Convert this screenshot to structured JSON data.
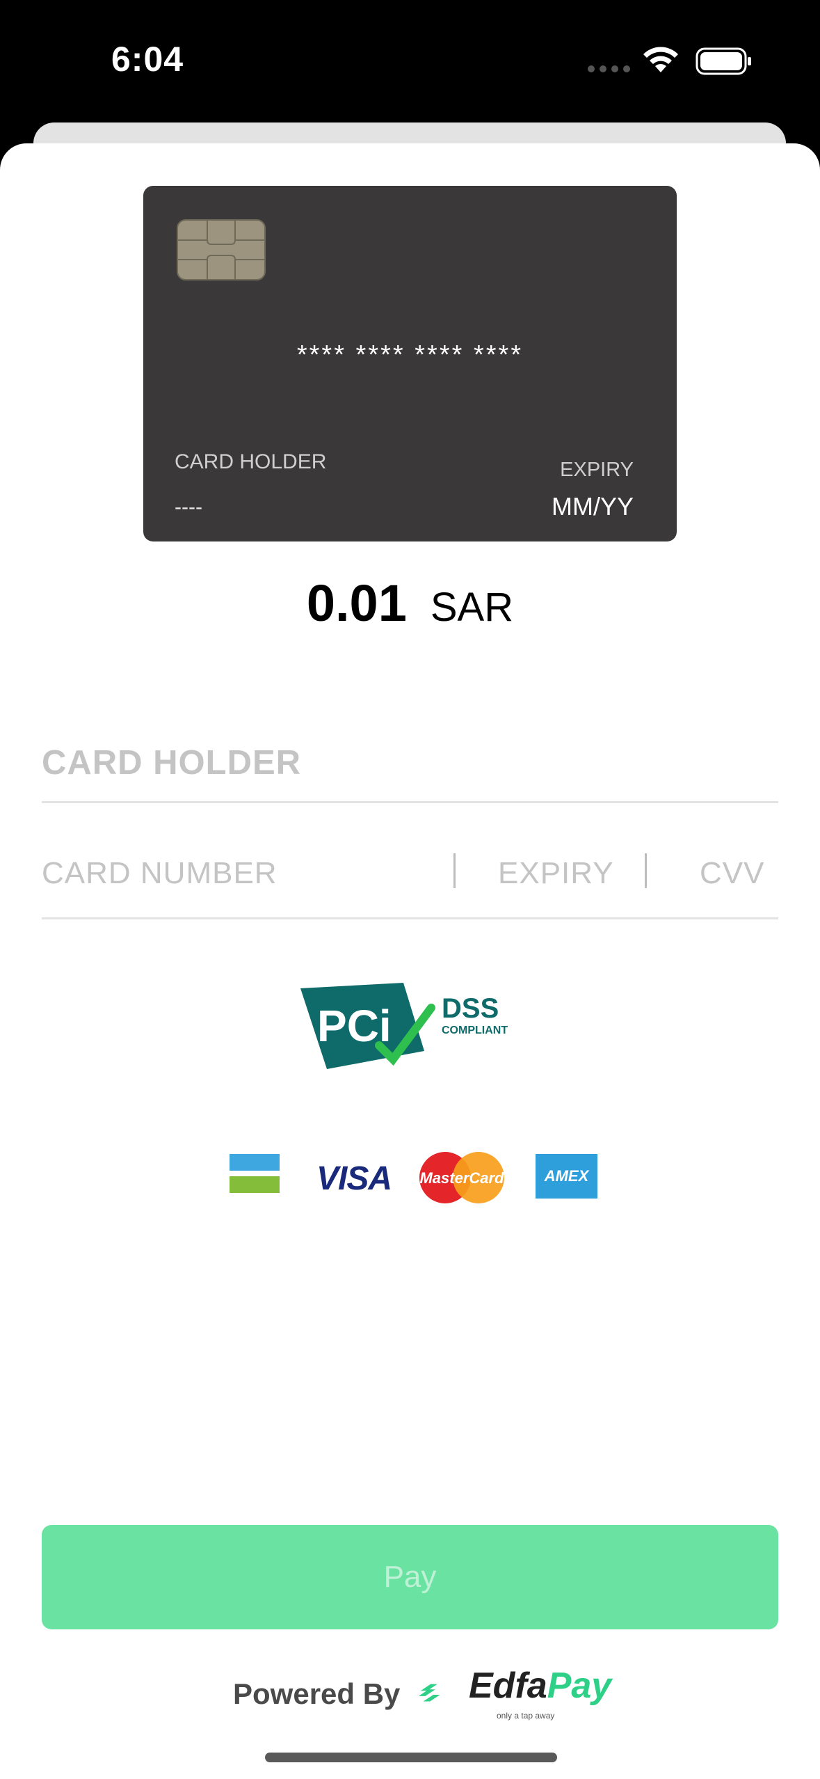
{
  "status_bar": {
    "time": "6:04"
  },
  "card_preview": {
    "number_mask": "**** **** **** ****",
    "holder_label": "CARD HOLDER",
    "holder_value": "----",
    "expiry_label": "EXPIRY",
    "expiry_value": "MM/YY",
    "color": "#3a3839"
  },
  "amount": {
    "value": "0.01",
    "currency": "SAR"
  },
  "form": {
    "card_holder_placeholder": "CARD HOLDER",
    "card_number_placeholder": "CARD NUMBER",
    "expiry_placeholder": "EXPIRY",
    "cvv_placeholder": "CVV"
  },
  "badges": {
    "pci": "PCI DSS COMPLIANT",
    "brands": [
      "mada",
      "VISA",
      "MasterCard",
      "AMEX"
    ]
  },
  "pay_button": {
    "label": "Pay",
    "color": "#6ae2a2"
  },
  "footer": {
    "powered_by": "Powered By",
    "brand_part1": "Edfa",
    "brand_part2": "Pay",
    "tagline": "only a tap away",
    "accent": "#2ecf86"
  }
}
